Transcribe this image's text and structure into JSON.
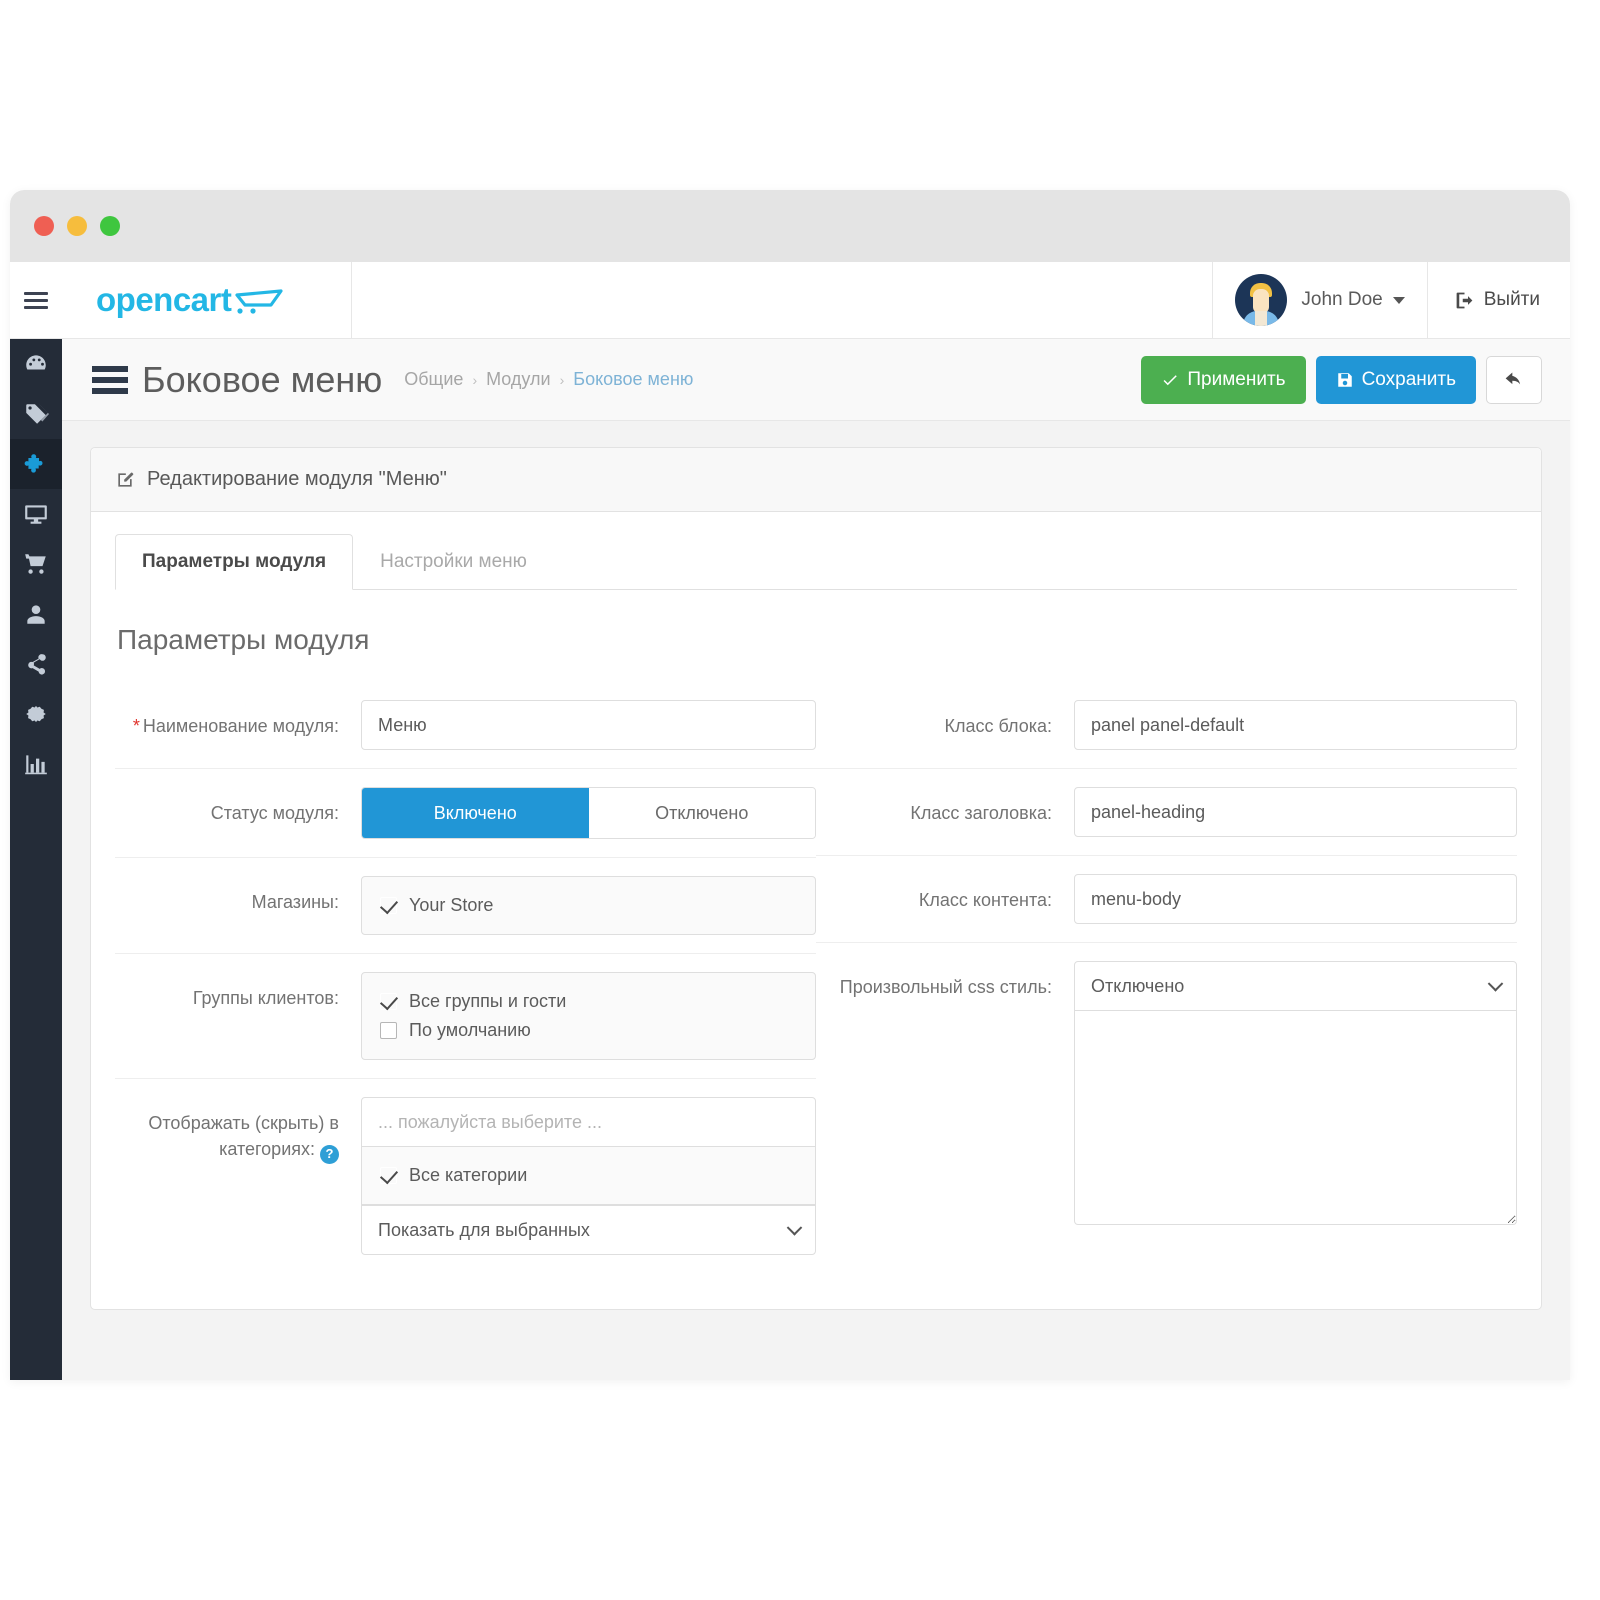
{
  "browser": {
    "traffic_lights": [
      "close",
      "minimize",
      "maximize"
    ]
  },
  "topbar": {
    "logo_text": "opencart",
    "logo_icon": "shopping-cart-icon",
    "menu_toggle_icon": "hamburger-icon",
    "user_name": "John Doe",
    "user_caret_icon": "caret-down-icon",
    "logout_label": "Выйти",
    "logout_icon": "sign-out-icon"
  },
  "sidebar": {
    "items": [
      {
        "name": "dashboard",
        "icon": "dashboard-icon",
        "active": false
      },
      {
        "name": "catalog",
        "icon": "tags-icon",
        "active": false
      },
      {
        "name": "extensions",
        "icon": "puzzle-piece-icon",
        "active": true
      },
      {
        "name": "design",
        "icon": "monitor-icon",
        "active": false
      },
      {
        "name": "sales",
        "icon": "shopping-cart-icon",
        "active": false
      },
      {
        "name": "customers",
        "icon": "user-icon",
        "active": false
      },
      {
        "name": "marketing",
        "icon": "share-icon",
        "active": false
      },
      {
        "name": "system",
        "icon": "gear-icon",
        "active": false
      },
      {
        "name": "reports",
        "icon": "bar-chart-icon",
        "active": false
      }
    ]
  },
  "page_header": {
    "menu_icon": "hamburger-icon",
    "title": "Боковое меню",
    "breadcrumb": [
      {
        "label": "Общие",
        "current": false
      },
      {
        "label": "Модули",
        "current": false
      },
      {
        "label": "Боковое меню",
        "current": true
      }
    ],
    "breadcrumb_separator": "›",
    "apply_label": "Применить",
    "apply_icon": "check-icon",
    "apply_color": "#4caf50",
    "save_label": "Сохранить",
    "save_icon": "floppy-disk-icon",
    "save_color": "#2196d6",
    "back_icon": "undo-arrow-icon"
  },
  "panel": {
    "heading": "Редактирование модуля \"Меню\"",
    "heading_icon": "pencil-square-icon",
    "tabs": [
      {
        "label": "Параметры модуля",
        "active": true
      },
      {
        "label": "Настройки меню",
        "active": false
      }
    ],
    "section_title": "Параметры модуля"
  },
  "form": {
    "left": {
      "module_name": {
        "label": "Наименование модуля:",
        "required": true,
        "value": "Меню"
      },
      "module_status": {
        "label": "Статус модуля:",
        "options": [
          {
            "label": "Включено",
            "selected": true
          },
          {
            "label": "Отключено",
            "selected": false
          }
        ]
      },
      "stores": {
        "label": "Магазины:",
        "items": [
          {
            "label": "Your Store",
            "checked": true
          }
        ]
      },
      "customer_groups": {
        "label": "Группы клиентов:",
        "items": [
          {
            "label": "Все группы и гости",
            "checked": true
          },
          {
            "label": "По умолчанию",
            "checked": false
          }
        ]
      },
      "categories": {
        "label_line1": "Отображать (скрыть) в",
        "label_line2": "категориях:",
        "help_icon": "question-mark-icon",
        "search_placeholder": "... пожалуйста выберите ...",
        "search_value": "",
        "items": [
          {
            "label": "Все категории",
            "checked": true
          }
        ],
        "mode_selected": "Показать для выбранных",
        "mode_options": [
          "Показать для выбранных"
        ]
      }
    },
    "right": {
      "block_class": {
        "label": "Класс блока:",
        "value": "panel panel-default"
      },
      "heading_class": {
        "label": "Класс заголовка:",
        "value": "panel-heading"
      },
      "content_class": {
        "label": "Класс контента:",
        "value": "menu-body"
      },
      "custom_css": {
        "label": "Произвольный css стиль:",
        "selected": "Отключено",
        "options": [
          "Отключено"
        ],
        "textarea_value": "",
        "textarea_placeholder": ""
      }
    }
  }
}
